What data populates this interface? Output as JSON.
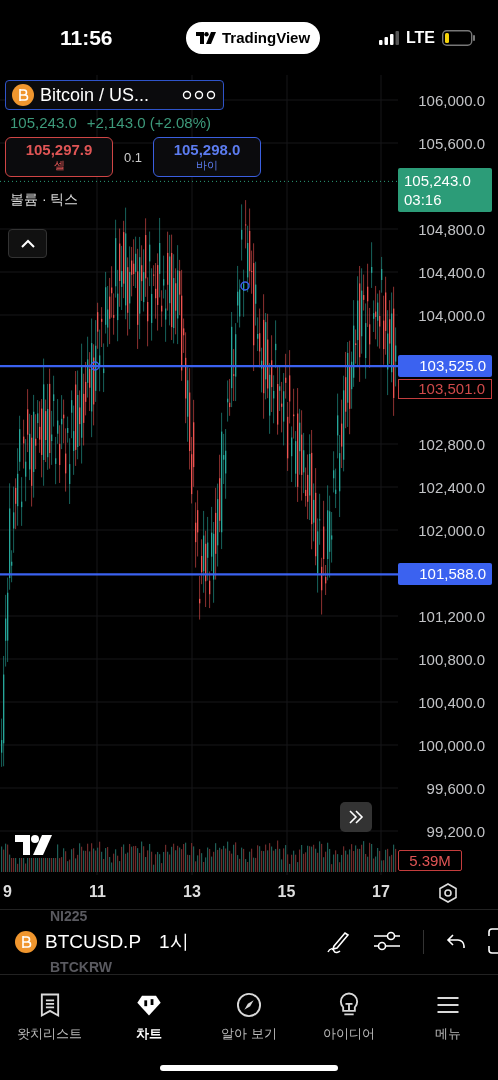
{
  "status_bar": {
    "time": "11:56",
    "app_pill": "TradingView",
    "network": "LTE"
  },
  "legend": {
    "symbol": "Bitcoin / US...",
    "last": "105,243.0",
    "change": "+2,143.0 (+2.08%)",
    "sell": {
      "price": "105,297.9",
      "label": "셀"
    },
    "spread": "0.1",
    "buy": {
      "price": "105,298.0",
      "label": "바이"
    },
    "indicator": "볼륨 · 틱스"
  },
  "price_axis": [
    "106,000.0",
    "105,600.0",
    "104,800.0",
    "104,400.0",
    "104,000.0",
    "102,800.0",
    "102,400.0",
    "102,000.0",
    "101,200.0",
    "100,800.0",
    "100,400.0",
    "100,000.0",
    "99,600.0",
    "99,200.0"
  ],
  "price_labels": [
    {
      "kind": "current",
      "price": "105,243.0",
      "timer": "03:16"
    },
    {
      "kind": "line",
      "price": "103,525.0"
    },
    {
      "kind": "bid",
      "price": "103,501.0"
    },
    {
      "kind": "line",
      "price": "101,588.0"
    },
    {
      "kind": "volume",
      "price": "5.39M"
    }
  ],
  "time_axis": [
    "9",
    "11",
    "13",
    "15",
    "17"
  ],
  "toolbar": {
    "ghost_above": "NI225",
    "symbol": "BTCUSD.P",
    "interval": "1시",
    "ghost_below": "BTCKRW"
  },
  "tabs": [
    {
      "label": "왓치리스트",
      "selected": false
    },
    {
      "label": "차트",
      "selected": true
    },
    {
      "label": "알아 보기",
      "selected": false
    },
    {
      "label": "아이디어",
      "selected": false
    },
    {
      "label": "메뉴",
      "selected": false
    }
  ]
}
